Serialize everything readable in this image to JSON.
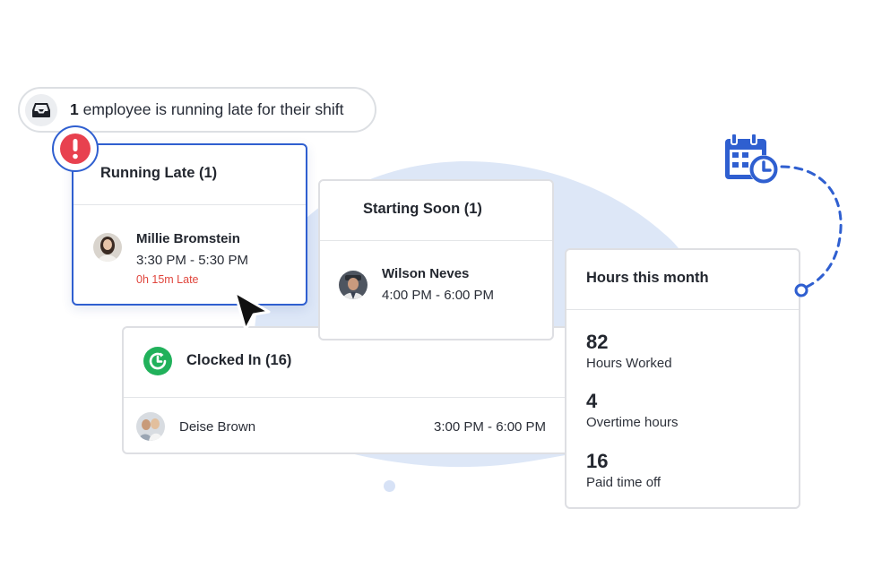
{
  "notification": {
    "count": "1",
    "message": "employee is running late for their shift",
    "icon": "inbox-icon"
  },
  "running_late": {
    "title": "Running Late (1)",
    "badge_icon": "alert-icon",
    "employee": {
      "name": "Millie Bromstein",
      "shift": "3:30 PM - 5:30 PM",
      "late_by": "0h 15m Late"
    }
  },
  "starting_soon": {
    "title": "Starting Soon (1)",
    "employee": {
      "name": "Wilson Neves",
      "shift": "4:00 PM - 6:00 PM"
    }
  },
  "clocked_in": {
    "title": "Clocked In (16)",
    "icon": "clock-icon",
    "employee": {
      "name": "Deise Brown",
      "shift": "3:00 PM - 6:00 PM"
    }
  },
  "hours": {
    "title": "Hours this month",
    "stats": [
      {
        "value": "82",
        "label": "Hours Worked"
      },
      {
        "value": "4",
        "label": "Overtime hours"
      },
      {
        "value": "16",
        "label": "Paid time off"
      }
    ]
  },
  "colors": {
    "accent": "#2f5fd0",
    "alert": "#e8414f",
    "clocked_green": "#21b15b",
    "late_text": "#e0463d",
    "blob": "#dde7f7"
  }
}
